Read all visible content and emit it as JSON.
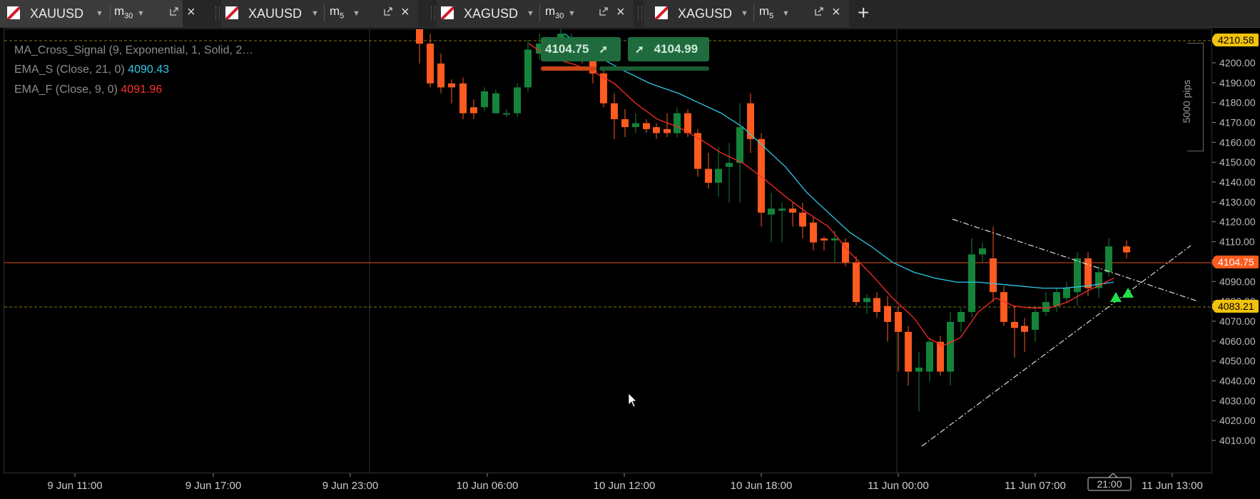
{
  "tabs": [
    {
      "symbol": "XAUUSD",
      "tf": "m",
      "tf_sub": "30",
      "active": true
    },
    {
      "symbol": "XAUUSD",
      "tf": "m",
      "tf_sub": "5",
      "active": false
    },
    {
      "symbol": "XAGUSD",
      "tf": "m",
      "tf_sub": "30",
      "active": false
    },
    {
      "symbol": "XAGUSD",
      "tf": "m",
      "tf_sub": "5",
      "active": false
    }
  ],
  "legend": {
    "line1": "MA_Cross_Signal (9, Exponential, 1, Solid, 2…",
    "line2_label": "EMA_S (Close, 21, 0)",
    "line2_value": "4090.43",
    "line3_label": "EMA_F (Close, 9, 0)",
    "line3_value": "4091.96"
  },
  "quick_trade": {
    "sell_price": "4104.75",
    "buy_price": "4104.99"
  },
  "scale_label": "5000 pips",
  "price_axis": {
    "ticks": [
      "4200.00",
      "4190.00",
      "4180.00",
      "4170.00",
      "4160.00",
      "4150.00",
      "4140.00",
      "4130.00",
      "4120.00",
      "4110.00",
      "4100.00",
      "4090.00",
      "4080.00",
      "4070.00",
      "4060.00",
      "4050.00",
      "4040.00",
      "4030.00",
      "4020.00",
      "4010.00"
    ],
    "tags": {
      "top": "4210.58",
      "current": "4104.75",
      "level": "4083.21"
    }
  },
  "time_axis": {
    "labels": [
      "9 Jun 11:00",
      "9 Jun 17:00",
      "9 Jun 23:00",
      "10 Jun 06:00",
      "10 Jun 12:00",
      "10 Jun 18:00",
      "11 Jun 00:00",
      "11 Jun 07:00",
      "11 Jun 13:00"
    ],
    "current_time": "21:00"
  },
  "colors": {
    "bull": "#14843a",
    "bear": "#ff5a1f",
    "ema_slow": "#2ec8e8",
    "ema_fast": "#ff2a2a",
    "current_line": "#e0501c",
    "level_line": "#8a7a14",
    "tag_yellow": "#f2c20c",
    "tag_orange": "#ff5a1f"
  }
}
